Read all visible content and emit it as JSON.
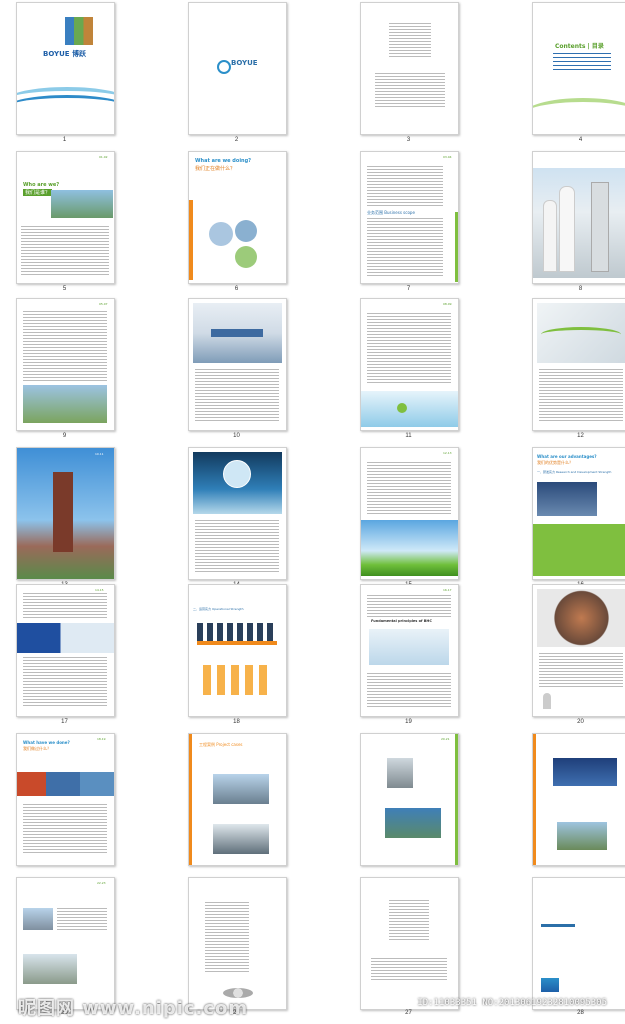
{
  "pages": [
    {
      "num": "1"
    },
    {
      "num": "2"
    },
    {
      "num": "3"
    },
    {
      "num": "4"
    },
    {
      "num": "5"
    },
    {
      "num": "6"
    },
    {
      "num": "7"
    },
    {
      "num": "8"
    },
    {
      "num": "9"
    },
    {
      "num": "10"
    },
    {
      "num": "11"
    },
    {
      "num": "12"
    },
    {
      "num": "13"
    },
    {
      "num": "14"
    },
    {
      "num": "15"
    },
    {
      "num": "16"
    },
    {
      "num": "17"
    },
    {
      "num": "18"
    },
    {
      "num": "19"
    },
    {
      "num": "20"
    },
    {
      "num": "21"
    },
    {
      "num": "22"
    },
    {
      "num": "23"
    },
    {
      "num": "24"
    },
    {
      "num": "25"
    },
    {
      "num": "26"
    },
    {
      "num": "27"
    },
    {
      "num": "28"
    }
  ],
  "p1": {
    "brand": "BOYUE 博跃"
  },
  "p2": {
    "brand": "BOYUE"
  },
  "p4": {
    "title": "Contents | 目录"
  },
  "p5": {
    "heading": "Who are we?",
    "sub": "我们是谁？",
    "pgno": "01.02"
  },
  "p6": {
    "heading": "What are we doing?",
    "sub": "我们正在做什么？"
  },
  "p7": {
    "pgno": "03.04",
    "section": "业务范围 Business scope"
  },
  "p9": {
    "pgno": "05.07"
  },
  "p11": {
    "pgno": "08.09"
  },
  "p13": {
    "pgno": "10.11"
  },
  "p15": {
    "pgno": "12.13"
  },
  "p16": {
    "heading": "What are our advantages?",
    "sub": "我们的优势是什么？",
    "section": "一、研发实力 Research and Development Strength"
  },
  "p17": {
    "pgno": "14.15"
  },
  "p18": {
    "section": "二、运营实力 Operational Strength"
  },
  "p19": {
    "pgno": "16.17",
    "title": "Fundamental principles of BHC"
  },
  "p21": {
    "heading": "What have we done?",
    "sub": "我们做过什么？",
    "pgno": "18.19"
  },
  "p22": {
    "title": "工程案例 Project cases"
  },
  "p23": {
    "pgno": "20.21"
  },
  "p25": {
    "pgno": "22.23"
  },
  "watermark": {
    "left": "昵图网 www.nipic.com",
    "right": "ID:11033351 NO:20130619232810095305"
  }
}
